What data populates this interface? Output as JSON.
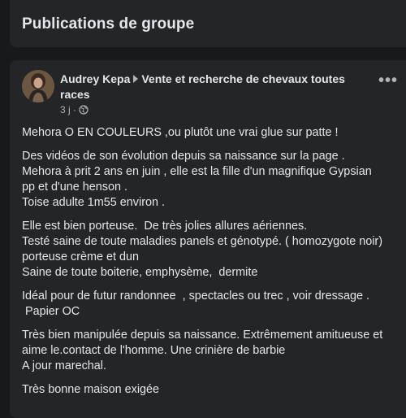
{
  "header": {
    "title": "Publications de groupe"
  },
  "post": {
    "author": "Audrey Kepa",
    "group": "Vente et recherche de chevaux toutes races",
    "time": "3 j",
    "more_label": "•••",
    "paragraphs": [
      [
        "Mehora O EN COULEURS ,ou plutôt une vrai glue sur patte !"
      ],
      [
        "Des vidéos de son évolution depuis sa naissance sur la page .",
        "Mehora à prit 2 ans en juin , elle est la fille d'un magnifique Gypsian",
        "pp et d'une henson .",
        "Toise adulte 1m55 environ ."
      ],
      [
        "Elle est bien porteuse.  De très jolies allures aériennes.",
        "Testé saine de toute maladies panels et génotypé. ( homozygote noir)",
        "porteuse crème et dun",
        "Saine de toute boiterie, emphysème,  dermite"
      ],
      [
        "Idéal pour de futur randonnee  , spectacles ou trec , voir dressage .",
        " Papier OC"
      ],
      [
        "Très bien manipulée depuis sa naissance. Extrêmement amitueuse et",
        "aime le.contact de l'homme. Une crinière de barbie",
        "A jour marechal."
      ],
      [
        "Très bonne maison exigée"
      ]
    ]
  }
}
